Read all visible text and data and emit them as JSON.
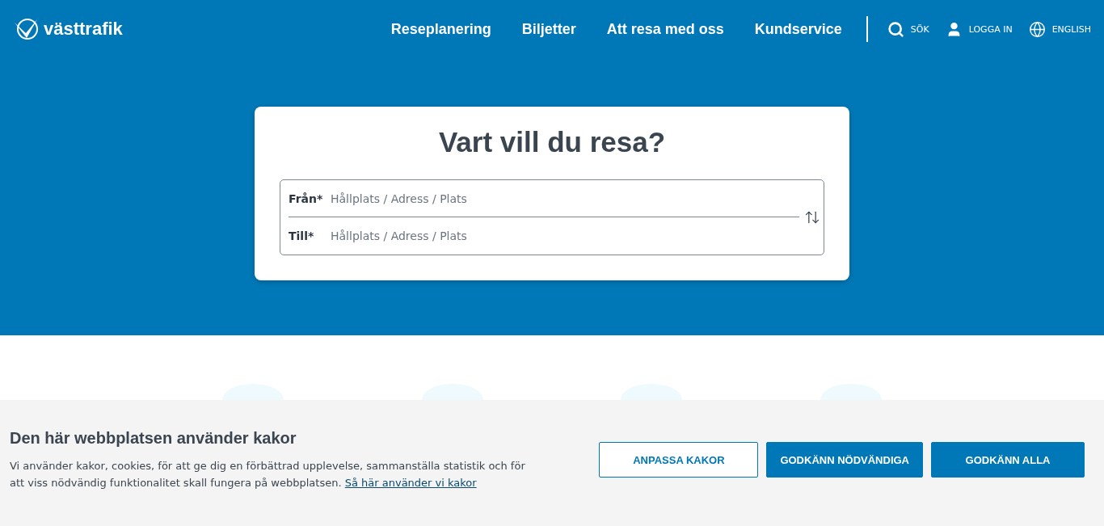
{
  "header": {
    "logo": "västtrafik",
    "nav": [
      "Reseplanering",
      "Biljetter",
      "Att resa med oss",
      "Kundservice"
    ],
    "utilities": [
      {
        "kind": "search",
        "label": "SÖK"
      },
      {
        "kind": "user",
        "label": "LOGGA IN"
      },
      {
        "kind": "globe",
        "label": "ENGLISH"
      }
    ]
  },
  "planner": {
    "title": "Vart vill du resa?",
    "fields": [
      {
        "label": "Från*",
        "placeholder": "Hållplats / Adress / Plats"
      },
      {
        "label": "Till*",
        "placeholder": "Hållplats / Adress / Plats"
      }
    ]
  },
  "feature_circles": [
    {
      "kind": "icon"
    },
    {
      "kind": "icon"
    },
    {
      "kind": "icon"
    },
    {
      "kind": "icon"
    }
  ],
  "cookie_banner": {
    "title": "Den här webbplatsen använder kakor",
    "text": "Vi använder kakor, cookies, för att ge dig en förbättrad upplevelse, sammanställa statistik och för att viss nödvändig funktionalitet skall fungera på webbplatsen.",
    "link": "Så här använder vi kakor",
    "buttons": [
      {
        "label": "ANPASSA KAKOR",
        "kind": "outline"
      },
      {
        "label": "GODKÄNN NÖDVÄNDIGA",
        "kind": "filled"
      },
      {
        "label": "GODKÄNN ALLA",
        "kind": "filled"
      }
    ]
  }
}
